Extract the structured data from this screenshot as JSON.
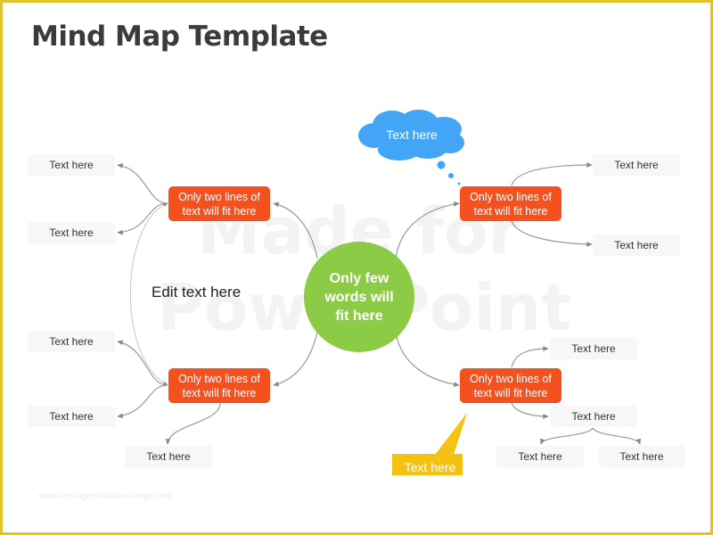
{
  "title": "Mind Map Template",
  "watermark": {
    "line1": "Made for",
    "line2": "PowerPoint"
  },
  "center": {
    "text": "Only few words will fit here",
    "color": "#8CCB45"
  },
  "branches": [
    {
      "id": "top-left",
      "text": "Only two lines of text will fit here"
    },
    {
      "id": "bottom-left",
      "text": "Only two lines of text will fit here"
    },
    {
      "id": "top-right",
      "text": "Only two lines of text will fit here"
    },
    {
      "id": "bottom-right",
      "text": "Only two lines of text will fit here"
    }
  ],
  "branch_color": "#F4511E",
  "leaves": [
    {
      "text": "Text here",
      "parent": "top-left"
    },
    {
      "text": "Text here",
      "parent": "top-left"
    },
    {
      "text": "Text here",
      "parent": "bottom-left"
    },
    {
      "text": "Text here",
      "parent": "bottom-left"
    },
    {
      "text": "Text here",
      "parent": "bottom-left"
    },
    {
      "text": "Text here",
      "parent": "top-right"
    },
    {
      "text": "Text here",
      "parent": "top-right"
    },
    {
      "text": "Text here",
      "parent": "bottom-right"
    },
    {
      "text": "Text here",
      "parent": "bottom-right"
    },
    {
      "text": "Text here",
      "parent": "bottom-right-leaf"
    },
    {
      "text": "Text here",
      "parent": "bottom-right-leaf"
    }
  ],
  "edit_text": "Edit text here",
  "thought_cloud": {
    "text": "Text here",
    "color": "#42A5F5"
  },
  "callout": {
    "text": "Text here",
    "color": "#F5C211"
  },
  "footer_url": "www.heritagechristiancollege.com",
  "frame_color": "#E3C22F"
}
